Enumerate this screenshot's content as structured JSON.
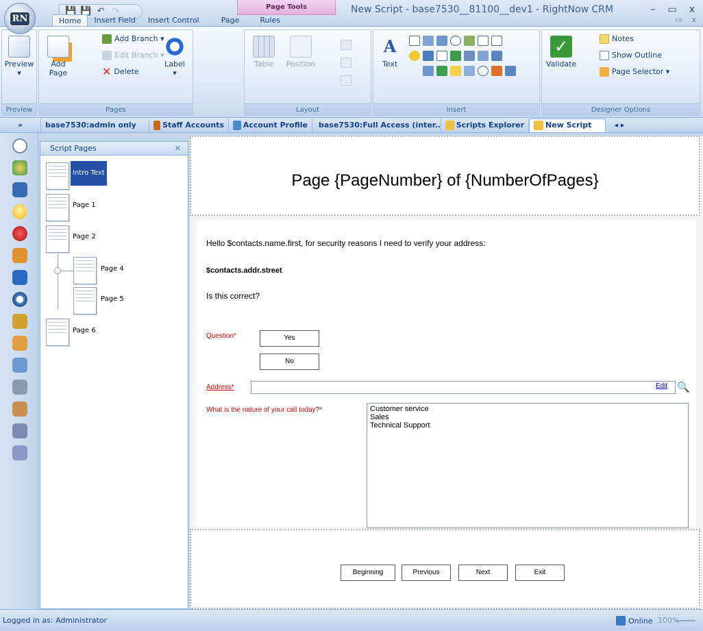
{
  "app": {
    "title": "New Script - base7530__81100__dev1  - RightNow CRM",
    "orb_label": "RN",
    "context_tab": "Page Tools",
    "window_buttons": [
      "–",
      "▭",
      "x"
    ]
  },
  "ribbon_tabs": [
    "Home",
    "Insert Field",
    "Insert Control",
    "Page",
    "Rules"
  ],
  "ribbon_right": [
    "▭",
    "x"
  ],
  "groups": {
    "preview": {
      "label": "Preview",
      "button": "Preview"
    },
    "pages": {
      "label": "Pages",
      "add_page": "Add Page",
      "add_branch": "Add Branch ▾",
      "edit_branch": "Edit Branch ▾",
      "delete": "Delete"
    },
    "label": {
      "button": "Label"
    },
    "layout": {
      "label": "Layout",
      "table": "Table",
      "position": "Position"
    },
    "insert": {
      "label": "Insert",
      "text": "Text"
    },
    "designer": {
      "label": "Designer Options",
      "validate": "Validate",
      "notes": "Notes",
      "show_outline": "Show Outline",
      "page_selector": "Page Selector ▾"
    }
  },
  "doc_tabs": [
    "base7530:admin only",
    "Staff Accounts",
    "Account Profile",
    "base7530:Full Access (inter...",
    "Scripts Explorer",
    "New Script"
  ],
  "doc_tabs_nav": "◂ ▸",
  "nav_collapse": "»",
  "script_pages": {
    "title": "Script Pages",
    "close": "✕",
    "pages": [
      "Intro Text",
      "Page 1",
      "Page 2",
      "Page 4",
      "Page 5",
      "Page 6"
    ]
  },
  "canvas": {
    "header_text": "Page {PageNumber} of {NumberOfPages}",
    "greeting": "Hello $contacts.name.first, for security reasons I need to verify your address:",
    "street": "$contacts.addr.street",
    "confirm": "Is this correct?",
    "question_label": "Question*",
    "yes": "Yes",
    "no": "No",
    "address_label": "Address*",
    "edit_link": "Edit",
    "nature_label": "What is the nature of your call today?*",
    "call_options": [
      "Customer service",
      "Sales",
      "Technical Support"
    ],
    "nav_buttons": [
      "Beginning",
      "Previous",
      "Next",
      "Exit"
    ]
  },
  "status": {
    "left": "Logged in as: Administrator",
    "online": "Online",
    "zoom": "100%"
  },
  "colors": {
    "accent": "#15428b",
    "selection": "#2450a8",
    "required": "#d40000"
  }
}
